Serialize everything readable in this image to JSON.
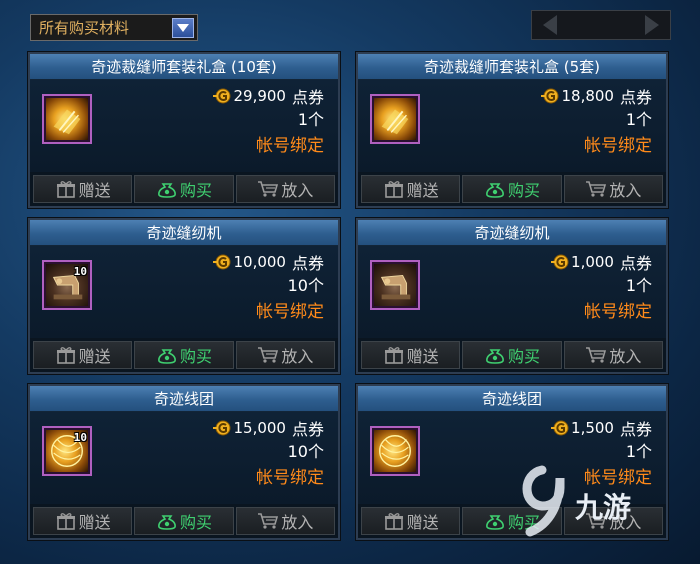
{
  "filter": {
    "label": "所有购买材料"
  },
  "cards": [
    {
      "title": "奇迹裁缝师套装礼盒 (10套)",
      "price": "29,900",
      "currency": "点券",
      "qty": "1个",
      "bind": "帐号绑定",
      "stack": "",
      "icon": "gift-box-icon"
    },
    {
      "title": "奇迹裁缝师套装礼盒 (5套)",
      "price": "18,800",
      "currency": "点券",
      "qty": "1个",
      "bind": "帐号绑定",
      "stack": "",
      "icon": "gift-box-icon"
    },
    {
      "title": "奇迹缝纫机",
      "price": "10,000",
      "currency": "点券",
      "qty": "10个",
      "bind": "帐号绑定",
      "stack": "10",
      "icon": "sewing-machine-icon"
    },
    {
      "title": "奇迹缝纫机",
      "price": "1,000",
      "currency": "点券",
      "qty": "1个",
      "bind": "帐号绑定",
      "stack": "",
      "icon": "sewing-machine-icon"
    },
    {
      "title": "奇迹线团",
      "price": "15,000",
      "currency": "点券",
      "qty": "10个",
      "bind": "帐号绑定",
      "stack": "10",
      "icon": "yarn-ball-icon"
    },
    {
      "title": "奇迹线团",
      "price": "1,500",
      "currency": "点券",
      "qty": "1个",
      "bind": "帐号绑定",
      "stack": "",
      "icon": "yarn-ball-icon"
    }
  ],
  "actions": {
    "gift": "赠送",
    "buy": "购买",
    "cart": "放入"
  },
  "watermark": {
    "text": "九游"
  },
  "colors": {
    "bind": "#ff8a1a",
    "buy": "#3fd070",
    "title_bar": "#2e5e8f"
  }
}
